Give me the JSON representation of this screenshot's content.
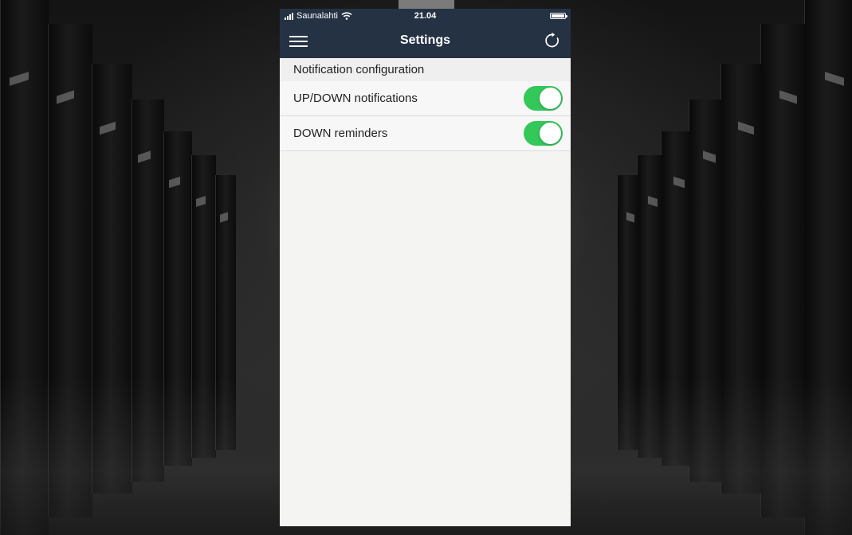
{
  "status_bar": {
    "carrier": "Saunalahti",
    "time": "21.04",
    "battery_level": 1.0
  },
  "navbar": {
    "title": "Settings",
    "menu_icon": "hamburger-menu-icon",
    "refresh_icon": "refresh-icon"
  },
  "section": {
    "header": "Notification configuration",
    "items": [
      {
        "label": "UP/DOWN notifications",
        "enabled": true
      },
      {
        "label": "DOWN reminders",
        "enabled": true
      }
    ]
  },
  "colors": {
    "navbar": "#253244",
    "toggle_on": "#34c759",
    "content_bg": "#f4f4f2"
  }
}
